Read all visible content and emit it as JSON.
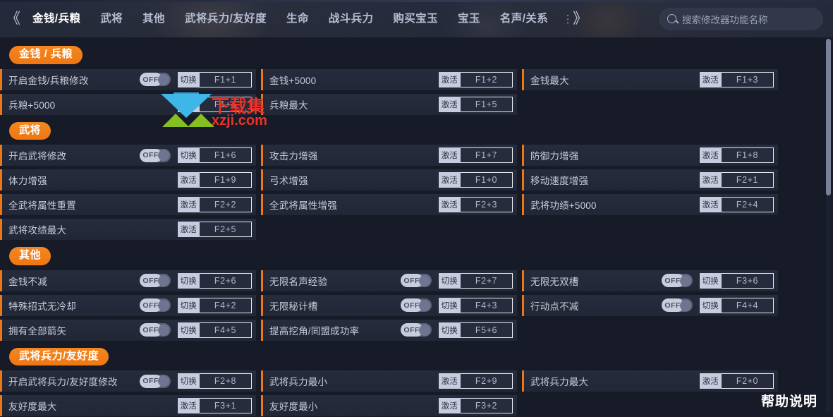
{
  "header": {
    "back_icon": "chevrons-left-icon",
    "back_glyph": "《",
    "overflow_dots": "⋮",
    "overflow_glyph": "》",
    "tabs": [
      {
        "label": "金钱/兵粮",
        "active": true
      },
      {
        "label": "武将",
        "active": false
      },
      {
        "label": "其他",
        "active": false
      },
      {
        "label": "武将兵力/友好度",
        "active": false
      },
      {
        "label": "生命",
        "active": false
      },
      {
        "label": "战斗兵力",
        "active": false
      },
      {
        "label": "购买宝玉",
        "active": false
      },
      {
        "label": "宝玉",
        "active": false
      },
      {
        "label": "名声/关系",
        "active": false
      }
    ],
    "search": {
      "icon": "search-icon",
      "placeholder": "搜索修改器功能名称",
      "value": ""
    }
  },
  "labels": {
    "toggle_off": "OFF",
    "action_switch": "切换",
    "action_activate": "激活"
  },
  "colors": {
    "accent_orange": "#ef7713",
    "row_bg": "#262c3c",
    "page_bg": "#171b28",
    "header_bg": "#242a3b"
  },
  "sections": [
    {
      "title": "金钱 / 兵粮",
      "rows": [
        [
          {
            "label": "开启金钱/兵粮修改",
            "type": "toggle",
            "state": "OFF",
            "action": "切换",
            "key": "F1+1"
          },
          {
            "label": "金钱+5000",
            "type": "activate",
            "action": "激活",
            "key": "F1+2"
          },
          {
            "label": "金钱最大",
            "type": "activate",
            "action": "激活",
            "key": "F1+3"
          }
        ],
        [
          {
            "label": "兵粮+5000",
            "type": "activate",
            "action": "激活",
            "key": "F1+4"
          },
          {
            "label": "兵粮最大",
            "type": "activate",
            "action": "激活",
            "key": "F1+5"
          },
          {
            "type": "empty"
          }
        ]
      ]
    },
    {
      "title": "武将",
      "rows": [
        [
          {
            "label": "开启武将修改",
            "type": "toggle",
            "state": "OFF",
            "action": "切换",
            "key": "F1+6"
          },
          {
            "label": "攻击力增强",
            "type": "activate",
            "action": "激活",
            "key": "F1+7"
          },
          {
            "label": "防御力增强",
            "type": "activate",
            "action": "激活",
            "key": "F1+8"
          }
        ],
        [
          {
            "label": "体力增强",
            "type": "activate",
            "action": "激活",
            "key": "F1+9"
          },
          {
            "label": "弓术增强",
            "type": "activate",
            "action": "激活",
            "key": "F1+0"
          },
          {
            "label": "移动速度增强",
            "type": "activate",
            "action": "激活",
            "key": "F2+1"
          }
        ],
        [
          {
            "label": "全武将属性重置",
            "type": "activate",
            "action": "激活",
            "key": "F2+2"
          },
          {
            "label": "全武将属性增强",
            "type": "activate",
            "action": "激活",
            "key": "F2+3"
          },
          {
            "label": "武将功绩+5000",
            "type": "activate",
            "action": "激活",
            "key": "F2+4"
          }
        ],
        [
          {
            "label": "武将攻绩最大",
            "type": "activate",
            "action": "激活",
            "key": "F2+5"
          },
          {
            "type": "empty"
          },
          {
            "type": "empty"
          }
        ]
      ]
    },
    {
      "title": "其他",
      "rows": [
        [
          {
            "label": "金钱不减",
            "type": "toggle",
            "state": "OFF",
            "action": "切换",
            "key": "F2+6"
          },
          {
            "label": "无限名声经验",
            "type": "toggle",
            "state": "OFF",
            "action": "切换",
            "key": "F2+7"
          },
          {
            "label": "无限无双槽",
            "type": "toggle",
            "state": "OFF",
            "action": "切换",
            "key": "F3+6"
          }
        ],
        [
          {
            "label": "特殊招式无冷却",
            "type": "toggle",
            "state": "OFF",
            "action": "切换",
            "key": "F4+2"
          },
          {
            "label": "无限秘计槽",
            "type": "toggle",
            "state": "OFF",
            "action": "切换",
            "key": "F4+3"
          },
          {
            "label": "行动点不减",
            "type": "toggle",
            "state": "OFF",
            "action": "切换",
            "key": "F4+4"
          }
        ],
        [
          {
            "label": "拥有全部箭矢",
            "type": "toggle",
            "state": "OFF",
            "action": "切换",
            "key": "F4+5"
          },
          {
            "label": "提高挖角/同盟成功率",
            "type": "toggle",
            "state": "OFF",
            "action": "切换",
            "key": "F5+6"
          },
          {
            "type": "empty"
          }
        ]
      ]
    },
    {
      "title": "武将兵力/友好度",
      "rows": [
        [
          {
            "label": "开启武将兵力/友好度修改",
            "type": "toggle",
            "state": "OFF",
            "action": "切换",
            "key": "F2+8"
          },
          {
            "label": "武将兵力最小",
            "type": "activate",
            "action": "激活",
            "key": "F2+9"
          },
          {
            "label": "武将兵力最大",
            "type": "activate",
            "action": "激活",
            "key": "F2+0"
          }
        ],
        [
          {
            "label": "友好度最大",
            "type": "activate",
            "action": "激活",
            "key": "F3+1"
          },
          {
            "label": "友好度最小",
            "type": "activate",
            "action": "激活",
            "key": "F3+2"
          },
          {
            "type": "empty"
          }
        ]
      ]
    }
  ],
  "watermark": {
    "text_top": "下载集",
    "text_bottom": "xzji.com"
  },
  "footer": {
    "help_label": "帮助说明"
  }
}
